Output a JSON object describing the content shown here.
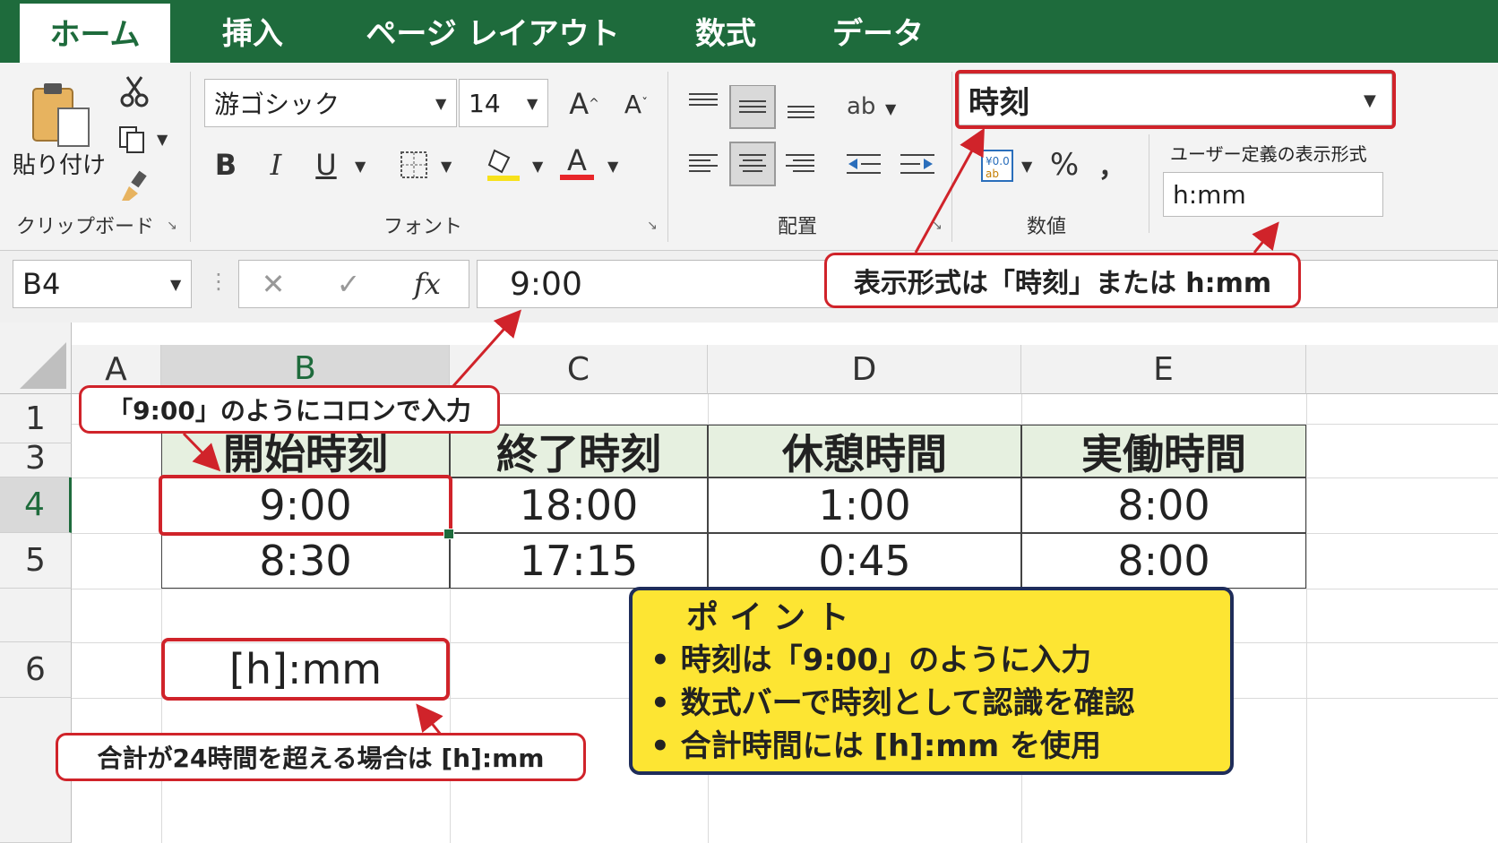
{
  "tabs": [
    {
      "label": "ホーム",
      "active": true
    },
    {
      "label": "挿入"
    },
    {
      "label": "ページ レイアウト"
    },
    {
      "label": "数式"
    },
    {
      "label": "データ"
    }
  ],
  "ribbon": {
    "clipboard": {
      "paste_label": "貼り付け",
      "group_label": "クリップボード"
    },
    "font": {
      "name": "游ゴシック",
      "size": "14",
      "grow": "A",
      "shrink": "A",
      "bold": "B",
      "italic": "I",
      "underline": "U",
      "font_color_glyph": "A",
      "group_label": "フォント"
    },
    "alignment": {
      "group_label": "配置"
    },
    "number": {
      "format": "時刻",
      "percent": "%",
      "comma": "，",
      "group_label": "数値",
      "custom_label": "ユーザー定義の表示形式",
      "custom_value": "h:mm"
    }
  },
  "formula_bar": {
    "name_box": "B4",
    "content": "9:00",
    "fx": "fx"
  },
  "grid": {
    "columns": [
      "A",
      "B",
      "C",
      "D",
      "E"
    ],
    "rows": [
      "1",
      "3",
      "4",
      "5",
      "6"
    ],
    "headers": [
      "開始時刻",
      "終了時刻",
      "休憩時間",
      "実働時間"
    ],
    "data": [
      [
        "9:00",
        "18:00",
        "1:00",
        "8:00"
      ],
      [
        "8:30",
        "17:15",
        "0:45",
        "8:00"
      ]
    ],
    "b6": "[h]:mm"
  },
  "callouts": {
    "colon": "「9:00」のようにコロンで入力",
    "format": "表示形式は「時刻」または h:mm",
    "over24": "合計が24時間を超える場合は [h]:mm"
  },
  "point": {
    "title": "ポ イ ン ト",
    "items": [
      "時刻は「9:00」のように入力",
      "数式バーで時刻として認識を確認",
      "合計時間には [h]:mm を使用"
    ]
  },
  "colors": {
    "excel_green": "#1e6b3c",
    "highlight_red": "#d0232a",
    "point_yellow": "#fde533",
    "point_border": "#1f2d5a",
    "header_fill": "#e6f0e0",
    "font_color_bar": "#e8262a",
    "fill_color_bar": "#f7e11b"
  }
}
